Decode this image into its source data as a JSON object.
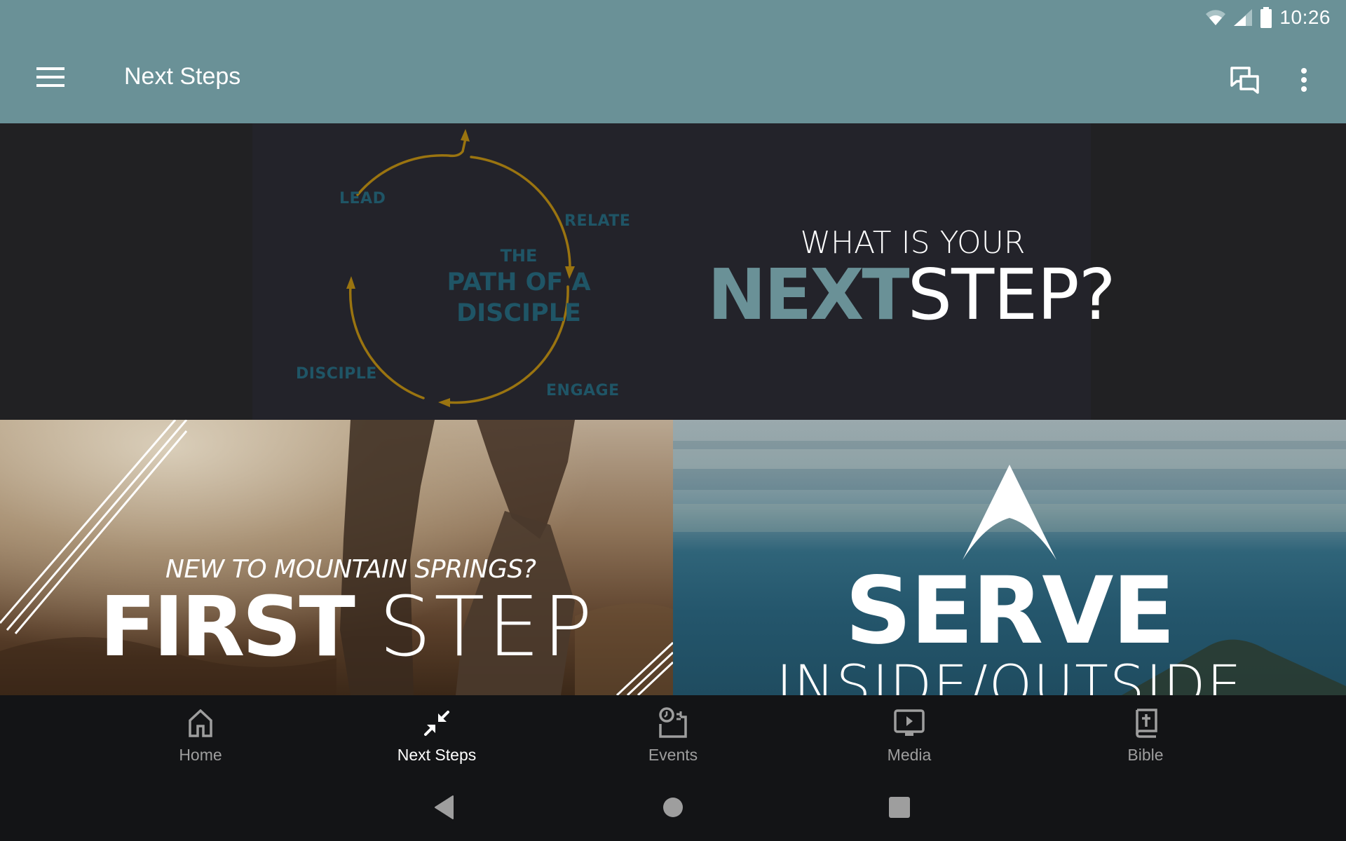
{
  "status_bar": {
    "time": "10:26",
    "icons": [
      "wifi-icon",
      "cell-signal-icon",
      "battery-icon"
    ]
  },
  "app_bar": {
    "title": "Next Steps",
    "menu_icon": "hamburger-menu-icon",
    "actions": [
      "chat-icon",
      "more-vert-icon"
    ]
  },
  "colors": {
    "brand_teal": "#6a9197",
    "diagram_gold": "#9a7410",
    "diagram_text": "#1f5566",
    "nav_background": "#131416",
    "nav_inactive": "#9e9e9e",
    "nav_active": "#ffffff"
  },
  "banner": {
    "diagram": {
      "title_small": "THE",
      "title_big_line1": "PATH OF A",
      "title_big_line2": "DISCIPLE",
      "stages": [
        "LEAD",
        "RELATE",
        "ENGAGE",
        "DISCIPLE"
      ]
    },
    "headline_top": "WHAT IS YOUR",
    "headline_bold": "NEXT",
    "headline_light": "STEP?"
  },
  "tiles": [
    {
      "subtitle": "NEW TO MOUNTAIN SPRINGS?",
      "title_bold": "FIRST",
      "title_light": "STEP"
    },
    {
      "title": "SERVE",
      "subtitle": "INSIDE/OUTSIDE"
    }
  ],
  "bottom_nav": {
    "items": [
      {
        "label": "Home",
        "icon": "home-icon",
        "active": false
      },
      {
        "label": "Next Steps",
        "icon": "next-steps-icon",
        "active": true
      },
      {
        "label": "Events",
        "icon": "events-icon",
        "active": false
      },
      {
        "label": "Media",
        "icon": "media-icon",
        "active": false
      },
      {
        "label": "Bible",
        "icon": "bible-icon",
        "active": false
      }
    ]
  },
  "system_nav": [
    "back-icon",
    "home-circle-icon",
    "recents-icon"
  ]
}
